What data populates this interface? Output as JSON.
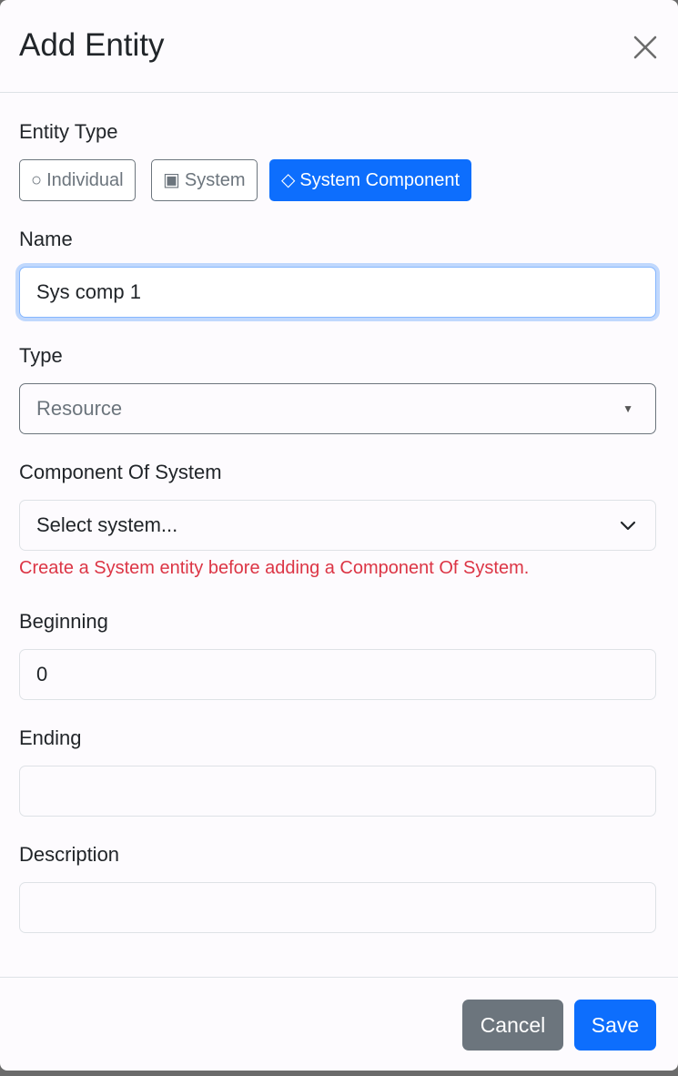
{
  "modal": {
    "title": "Add Entity",
    "close_icon": "close-x-icon"
  },
  "entity_type": {
    "label": "Entity Type",
    "options": [
      {
        "glyph": "○",
        "label": "Individual",
        "icon": "circle-icon",
        "selected": false
      },
      {
        "glyph": "▣",
        "label": "System",
        "icon": "square-icon",
        "selected": false
      },
      {
        "glyph": "◇",
        "label": "System Component",
        "icon": "diamond-icon",
        "selected": true
      }
    ]
  },
  "name": {
    "label": "Name",
    "value": "Sys comp 1"
  },
  "type": {
    "label": "Type",
    "value": "Resource",
    "dropdown_icon": "triangle-down-icon"
  },
  "component_of_system": {
    "label": "Component Of System",
    "value": "Select system...",
    "dropdown_icon": "chevron-down-icon",
    "error": "Create a System entity before adding a Component Of System."
  },
  "beginning": {
    "label": "Beginning",
    "value": "0"
  },
  "ending": {
    "label": "Ending",
    "value": ""
  },
  "description": {
    "label": "Description",
    "value": ""
  },
  "footer": {
    "cancel_label": "Cancel",
    "save_label": "Save"
  },
  "colors": {
    "primary": "#0d6efd",
    "secondary": "#6c757d",
    "danger": "#dc3545",
    "background": "#fdfbfe"
  }
}
